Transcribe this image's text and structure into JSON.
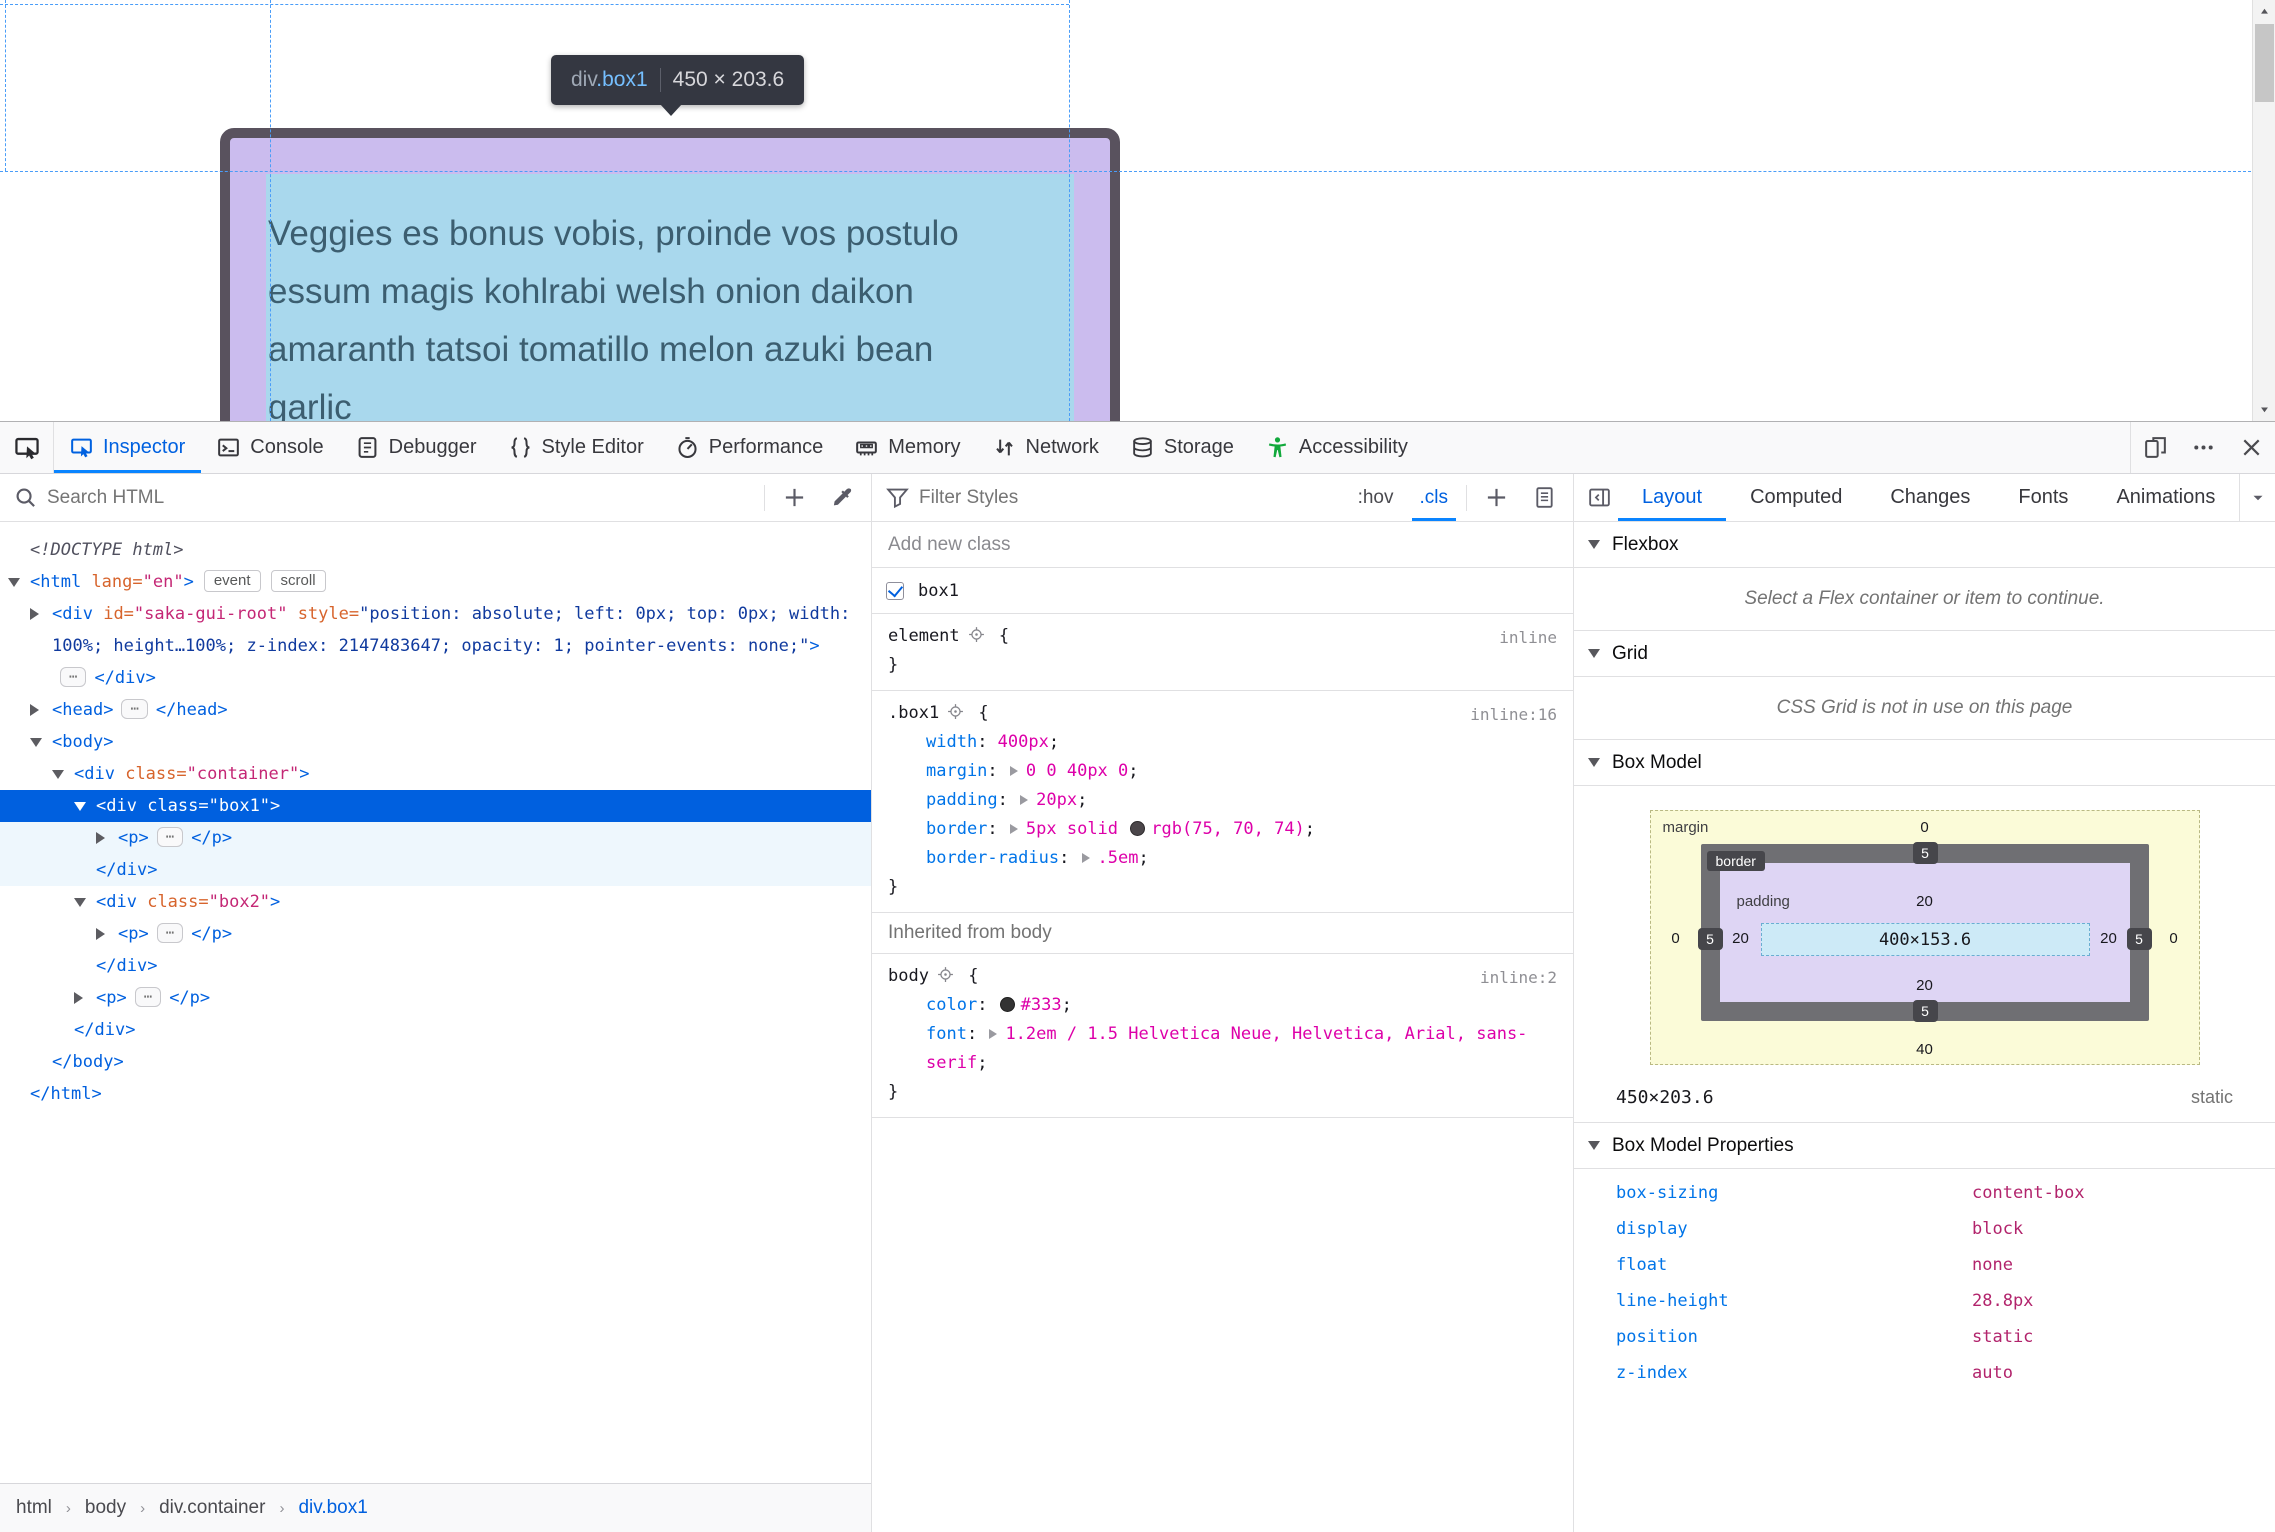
{
  "theme": {
    "accent": "#0a84ff",
    "selection_blue": "#0060df",
    "accessibility_green": "#12a93c"
  },
  "page": {
    "tooltip": {
      "tag": "div",
      "className": ".box1",
      "dims": "450 × 203.6"
    },
    "text_lines": [
      "Veggies es bonus vobis, proinde vos postulo",
      "essum magis kohlrabi welsh onion daikon",
      "amaranth tatsoi tomatillo melon azuki bean",
      "garlic"
    ]
  },
  "tabbar": {
    "tabs": [
      {
        "id": "inspector",
        "label": "Inspector",
        "active": true
      },
      {
        "id": "console",
        "label": "Console"
      },
      {
        "id": "debugger",
        "label": "Debugger"
      },
      {
        "id": "style-editor",
        "label": "Style Editor"
      },
      {
        "id": "performance",
        "label": "Performance"
      },
      {
        "id": "memory",
        "label": "Memory"
      },
      {
        "id": "network",
        "label": "Network"
      },
      {
        "id": "storage",
        "label": "Storage"
      },
      {
        "id": "accessibility",
        "label": "Accessibility"
      }
    ],
    "window_icons": [
      "rdm",
      "meatball-menu",
      "close"
    ]
  },
  "markup": {
    "search_placeholder": "Search HTML",
    "breadcrumb": [
      "html",
      "body",
      "div.container",
      "div.box1"
    ],
    "breadcrumb_sep": "›",
    "rows": [
      {
        "lvl": 0,
        "tokens": [
          [
            "doctype",
            "<!DOCTYPE html>"
          ]
        ]
      },
      {
        "lvl": 0,
        "arrow": "open",
        "tokens": [
          [
            "punc",
            "<"
          ],
          [
            "tag",
            "html"
          ],
          [
            "attr",
            " lang="
          ],
          [
            "val",
            "\"en\""
          ],
          [
            "punc",
            ">"
          ],
          [
            "badge",
            "event"
          ],
          [
            "badge",
            "scroll"
          ]
        ]
      },
      {
        "lvl": 1,
        "arrow": "closed",
        "tokens": [
          [
            "punc",
            "<"
          ],
          [
            "tag",
            "div"
          ],
          [
            "attr",
            " id="
          ],
          [
            "val",
            "\"saka-gui-root\""
          ],
          [
            "attr",
            " style="
          ],
          [
            "valnav",
            "\"position: absolute; left: 0px; top: 0px; width: 100%; height…100%; z-index: 2147483647; opacity: 1; pointer-events: none;\""
          ],
          [
            "punc",
            ">"
          ],
          [
            "chip",
            "⋯"
          ],
          [
            "punc",
            "</"
          ],
          [
            "tag",
            "div"
          ],
          [
            "punc",
            ">"
          ]
        ]
      },
      {
        "lvl": 1,
        "arrow": "closed",
        "tokens": [
          [
            "punc",
            "<"
          ],
          [
            "tag",
            "head"
          ],
          [
            "punc",
            ">"
          ],
          [
            "chip",
            "⋯"
          ],
          [
            "punc",
            "</"
          ],
          [
            "tag",
            "head"
          ],
          [
            "punc",
            ">"
          ]
        ]
      },
      {
        "lvl": 1,
        "arrow": "open",
        "tokens": [
          [
            "punc",
            "<"
          ],
          [
            "tag",
            "body"
          ],
          [
            "punc",
            ">"
          ]
        ]
      },
      {
        "lvl": 2,
        "arrow": "open",
        "tokens": [
          [
            "punc",
            "<"
          ],
          [
            "tag",
            "div"
          ],
          [
            "attr",
            " class="
          ],
          [
            "val",
            "\"container\""
          ],
          [
            "punc",
            ">"
          ]
        ]
      },
      {
        "lvl": 3,
        "arrow": "open",
        "sel": true,
        "tokens": [
          [
            "punc",
            "<"
          ],
          [
            "tag",
            "div"
          ],
          [
            "attr",
            " class="
          ],
          [
            "val",
            "\"box1\""
          ],
          [
            "punc",
            ">"
          ]
        ]
      },
      {
        "lvl": 4,
        "arrow": "closed",
        "child": true,
        "tokens": [
          [
            "punc",
            "<"
          ],
          [
            "tag",
            "p"
          ],
          [
            "punc",
            ">"
          ],
          [
            "chip",
            "⋯"
          ],
          [
            "punc",
            "</"
          ],
          [
            "tag",
            "p"
          ],
          [
            "punc",
            ">"
          ]
        ]
      },
      {
        "lvl": 3,
        "child": true,
        "tokens": [
          [
            "punc",
            "</"
          ],
          [
            "tag",
            "div"
          ],
          [
            "punc",
            ">"
          ]
        ]
      },
      {
        "lvl": 3,
        "arrow": "open",
        "tokens": [
          [
            "punc",
            "<"
          ],
          [
            "tag",
            "div"
          ],
          [
            "attr",
            " class="
          ],
          [
            "val",
            "\"box2\""
          ],
          [
            "punc",
            ">"
          ]
        ]
      },
      {
        "lvl": 4,
        "arrow": "closed",
        "tokens": [
          [
            "punc",
            "<"
          ],
          [
            "tag",
            "p"
          ],
          [
            "punc",
            ">"
          ],
          [
            "chip",
            "⋯"
          ],
          [
            "punc",
            "</"
          ],
          [
            "tag",
            "p"
          ],
          [
            "punc",
            ">"
          ]
        ]
      },
      {
        "lvl": 3,
        "tokens": [
          [
            "punc",
            "</"
          ],
          [
            "tag",
            "div"
          ],
          [
            "punc",
            ">"
          ]
        ]
      },
      {
        "lvl": 3,
        "arrow": "closed",
        "tokens": [
          [
            "punc",
            "<"
          ],
          [
            "tag",
            "p"
          ],
          [
            "punc",
            ">"
          ],
          [
            "chip",
            "⋯"
          ],
          [
            "punc",
            "</"
          ],
          [
            "tag",
            "p"
          ],
          [
            "punc",
            ">"
          ]
        ]
      },
      {
        "lvl": 2,
        "tokens": [
          [
            "punc",
            "</"
          ],
          [
            "tag",
            "div"
          ],
          [
            "punc",
            ">"
          ]
        ]
      },
      {
        "lvl": 1,
        "tokens": [
          [
            "punc",
            "</"
          ],
          [
            "tag",
            "body"
          ],
          [
            "punc",
            ">"
          ]
        ]
      },
      {
        "lvl": 0,
        "tokens": [
          [
            "punc",
            "</"
          ],
          [
            "tag",
            "html"
          ],
          [
            "punc",
            ">"
          ]
        ]
      }
    ]
  },
  "rules": {
    "filter_placeholder": "Filter Styles",
    "pseudo_toggle": ":hov",
    "class_toggle": ".cls",
    "add_new_class": "Add new class",
    "brace_open": "{",
    "brace_close": "}",
    "colon": ":",
    "semi": ";",
    "class_checkboxes": [
      {
        "checked": true,
        "label": "box1"
      }
    ],
    "blocks": [
      {
        "selector": "element",
        "link": "inline",
        "decls": []
      },
      {
        "selector": ".box1",
        "link": "inline:16",
        "decls": [
          {
            "name": "width",
            "tokens": [
              [
                "t",
                "400px"
              ]
            ]
          },
          {
            "name": "margin",
            "tokens": [
              [
                "a"
              ],
              [
                "t",
                "0 0 40px 0"
              ]
            ]
          },
          {
            "name": "padding",
            "tokens": [
              [
                "a"
              ],
              [
                "t",
                "20px"
              ]
            ]
          },
          {
            "name": "border",
            "tokens": [
              [
                "a"
              ],
              [
                "t",
                "5px solid "
              ],
              [
                "s",
                "#4b464a"
              ],
              [
                "t",
                "rgb(75, 70, 74)"
              ]
            ]
          },
          {
            "name": "border-radius",
            "tokens": [
              [
                "a"
              ],
              [
                "t",
                ".5em"
              ]
            ]
          }
        ]
      }
    ],
    "inherited_header": "Inherited from body",
    "inherited_blocks": [
      {
        "selector": "body",
        "link": "inline:2",
        "decls": [
          {
            "name": "color",
            "tokens": [
              [
                "s",
                "#333333"
              ],
              [
                "t",
                "#333"
              ]
            ]
          },
          {
            "name": "font",
            "tokens": [
              [
                "a"
              ],
              [
                "t",
                "1.2em / 1.5 Helvetica Neue, Helvetica, Arial, sans-serif"
              ]
            ]
          }
        ]
      }
    ]
  },
  "layout": {
    "tabs": [
      {
        "label": "Layout",
        "active": true
      },
      {
        "label": "Computed"
      },
      {
        "label": "Changes"
      },
      {
        "label": "Fonts"
      },
      {
        "label": "Animations"
      }
    ],
    "flexbox": {
      "title": "Flexbox",
      "message": "Select a Flex container or item to continue."
    },
    "grid": {
      "title": "Grid",
      "message": "CSS Grid is not in use on this page"
    },
    "box_model": {
      "title": "Box Model",
      "margin_label": "margin",
      "border_label": "border",
      "padding_label": "padding",
      "margin_top": "0",
      "margin_left": "0",
      "margin_right": "0",
      "margin_bottom": "40",
      "border_top": "5",
      "border_left": "5",
      "border_right": "5",
      "border_bottom": "5",
      "padding_top": "20",
      "padding_left": "20",
      "padding_right": "20",
      "padding_bottom": "20",
      "content": "400×153.6",
      "dims": "450×203.6",
      "position": "static"
    },
    "properties": {
      "title": "Box Model Properties",
      "items": [
        {
          "name": "box-sizing",
          "value": "content-box"
        },
        {
          "name": "display",
          "value": "block"
        },
        {
          "name": "float",
          "value": "none"
        },
        {
          "name": "line-height",
          "value": "28.8px"
        },
        {
          "name": "position",
          "value": "static"
        },
        {
          "name": "z-index",
          "value": "auto"
        }
      ]
    }
  }
}
